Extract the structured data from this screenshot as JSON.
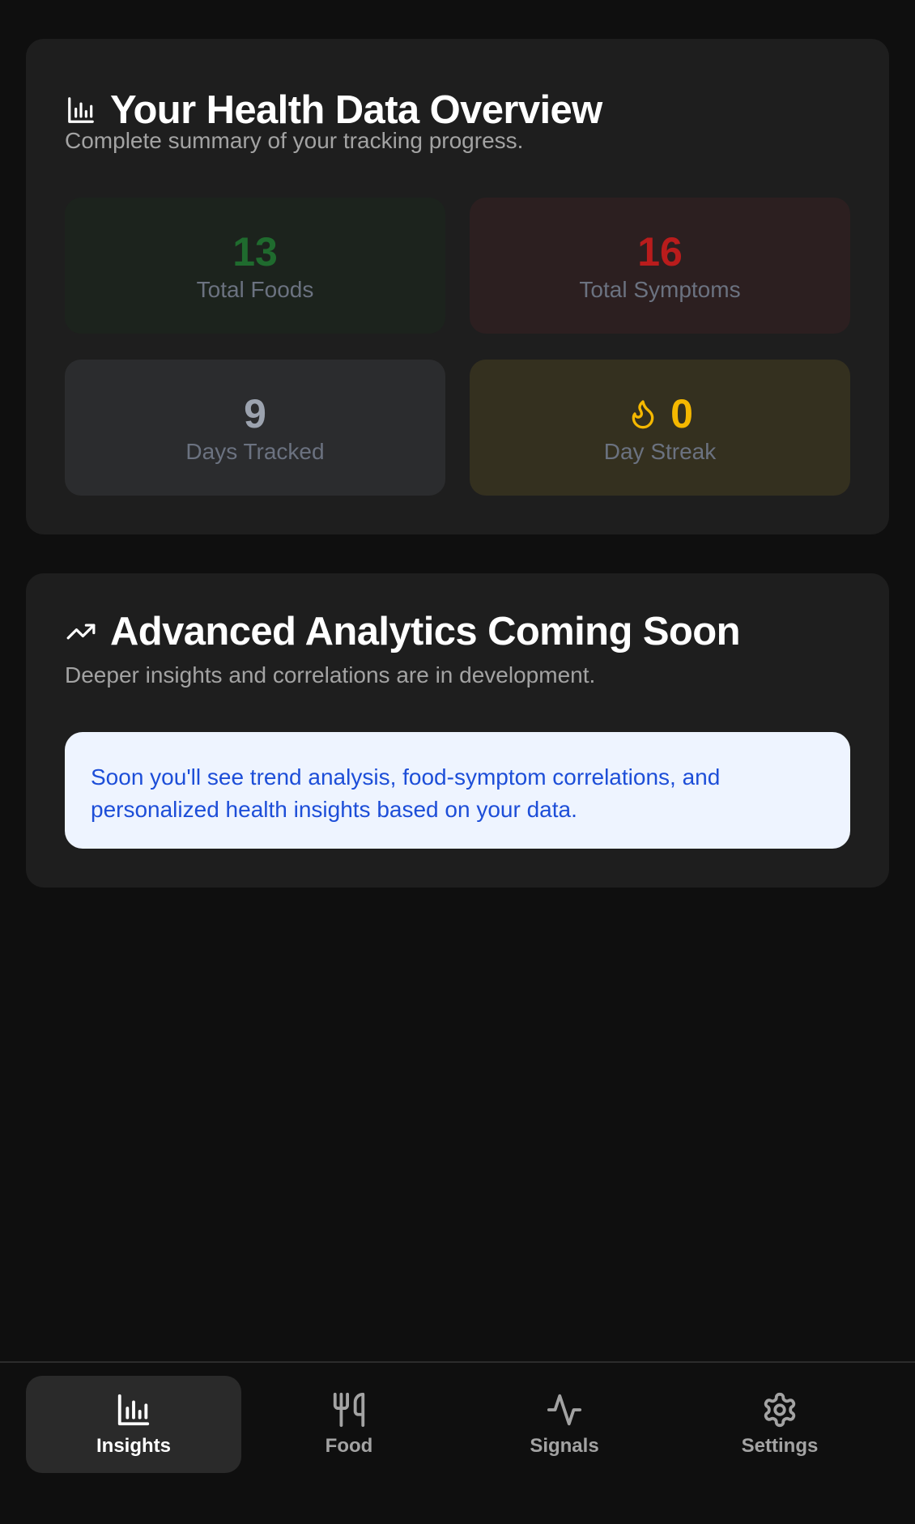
{
  "overview": {
    "title": "Your Health Data Overview",
    "subtitle": "Complete summary of your tracking progress.",
    "title_icon": "bar-chart-icon",
    "stats": {
      "foods": {
        "value": "13",
        "label": "Total Foods",
        "color": "#1f6b2e"
      },
      "symptoms": {
        "value": "16",
        "label": "Total Symptoms",
        "color": "#b91c1c"
      },
      "days": {
        "value": "9",
        "label": "Days Tracked",
        "color": "#9ca3af"
      },
      "streak": {
        "value": "0",
        "label": "Day Streak",
        "color": "#f5b800",
        "icon": "flame-icon"
      }
    }
  },
  "analytics": {
    "title": "Advanced Analytics Coming Soon",
    "subtitle": "Deeper insights and correlations are in development.",
    "title_icon": "trending-up-icon",
    "notice": "Soon you'll see trend analysis, food-symptom correlations, and personalized health insights based on your data."
  },
  "nav": {
    "items": [
      {
        "label": "Insights",
        "icon": "bar-chart-icon",
        "active": true
      },
      {
        "label": "Food",
        "icon": "utensils-icon",
        "active": false
      },
      {
        "label": "Signals",
        "icon": "activity-icon",
        "active": false
      },
      {
        "label": "Settings",
        "icon": "gear-icon",
        "active": false
      }
    ]
  }
}
